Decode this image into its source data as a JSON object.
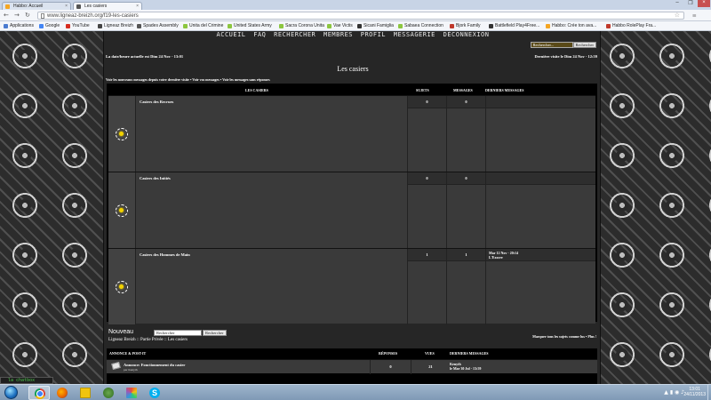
{
  "browser": {
    "tabs": [
      {
        "label": "Habbo: Accueil",
        "icon_color": "#f5a623"
      },
      {
        "label": "Les casiers",
        "icon_color": "#555555"
      }
    ],
    "url": "www.ligneaz-breizh.org/f19-les-casiers",
    "bookmarks": [
      {
        "label": "Applications",
        "icon_color": "#4a7bd0"
      },
      {
        "label": "Google",
        "icon_color": "#4285f4"
      },
      {
        "label": "YouTube",
        "icon_color": "#d62d20"
      },
      {
        "label": "Ligneaz Breizh",
        "icon_color": "#444444"
      },
      {
        "label": "Spades Assembly",
        "icon_color": "#555555"
      },
      {
        "label": "Unita del Crimine",
        "icon_color": "#8cc63f"
      },
      {
        "label": "United States Army",
        "icon_color": "#8cc63f"
      },
      {
        "label": "Sacra Corona Unita",
        "icon_color": "#8cc63f"
      },
      {
        "label": "Vae Victis",
        "icon_color": "#8cc63f"
      },
      {
        "label": "Sicani Famiglia",
        "icon_color": "#333333"
      },
      {
        "label": "Sabaea Connection",
        "icon_color": "#8cc63f"
      },
      {
        "label": "Bjork Family",
        "icon_color": "#c0392b"
      },
      {
        "label": "Battlefield Play4Free...",
        "icon_color": "#333333"
      },
      {
        "label": "Habbo: Crée ton ava...",
        "icon_color": "#f5a623"
      },
      {
        "label": "Habbo RolePlay Fra...",
        "icon_color": "#c0392b"
      }
    ]
  },
  "forum": {
    "nav": [
      "ACCUEIL",
      "FAQ",
      "RECHERCHER",
      "MEMBRES",
      "PROFIL",
      "MESSAGERIE",
      "DÉCONNEXION"
    ],
    "search_top": {
      "placeholder": "Rechercher...",
      "button": "Rechercher"
    },
    "datetime": "La date/heure actuelle est Dim 24 Nov - 13:01",
    "last_visit": "Dernière visite le Dim 24 Nov - 12:59",
    "page_title": "Les casiers",
    "quick_links": "Voir les nouveaux messages depuis votre dernière visite • Voir vos messages • Voir les messages sans réponses",
    "headers": {
      "forums": "LES CASIERS",
      "topics": "SUJETS",
      "posts": "MESSAGES",
      "last": "DERNIERS MESSAGES"
    },
    "rows": [
      {
        "name": "Casiers des Recrues",
        "topics": "0",
        "posts": "0",
        "last_date": "",
        "last_user": ""
      },
      {
        "name": "Casiers des Initiés",
        "topics": "0",
        "posts": "0",
        "last_date": "",
        "last_user": ""
      },
      {
        "name": "Casiers des Hommes de Main",
        "topics": "1",
        "posts": "1",
        "last_date": "Mar 12 Nov - 20:14",
        "last_user": "L'Exocre"
      }
    ],
    "new_button": "Nouveau",
    "search_bottom": {
      "value": "Rechercher",
      "button": "Rechercher"
    },
    "breadcrumb": "Ligneaz Breizh :: Partie Privée :: Les casiers",
    "mark_read": "Marquer tous les sujets comme lus • Plus !",
    "announce": {
      "headers": {
        "title": "ANNONCE & POST-IT",
        "replies": "RÉPONSES",
        "views": "VUES",
        "last": "DERNIERS MESSAGES"
      },
      "title": "Annonce: Fonctionnement du casier",
      "author": "par Kenyth",
      "replies": "0",
      "views": "21",
      "last_user": "Kenyth",
      "last_date": "le Mar 30 Jul - 13:59"
    }
  },
  "chatbox": "la chatbox",
  "taskbar": {
    "time": "13:01",
    "date": "24/11/2013",
    "apps": [
      {
        "name": "chrome",
        "color": "#e3b23c",
        "active": true
      },
      {
        "name": "firefox",
        "color": "#e66000",
        "active": false
      },
      {
        "name": "explorer",
        "color": "#f1c40f",
        "active": false
      },
      {
        "name": "network",
        "color": "#6aa84f",
        "active": false
      },
      {
        "name": "paint",
        "color": "#c27ba0",
        "active": false
      },
      {
        "name": "skype",
        "color": "#00aff0",
        "active": false
      }
    ]
  }
}
